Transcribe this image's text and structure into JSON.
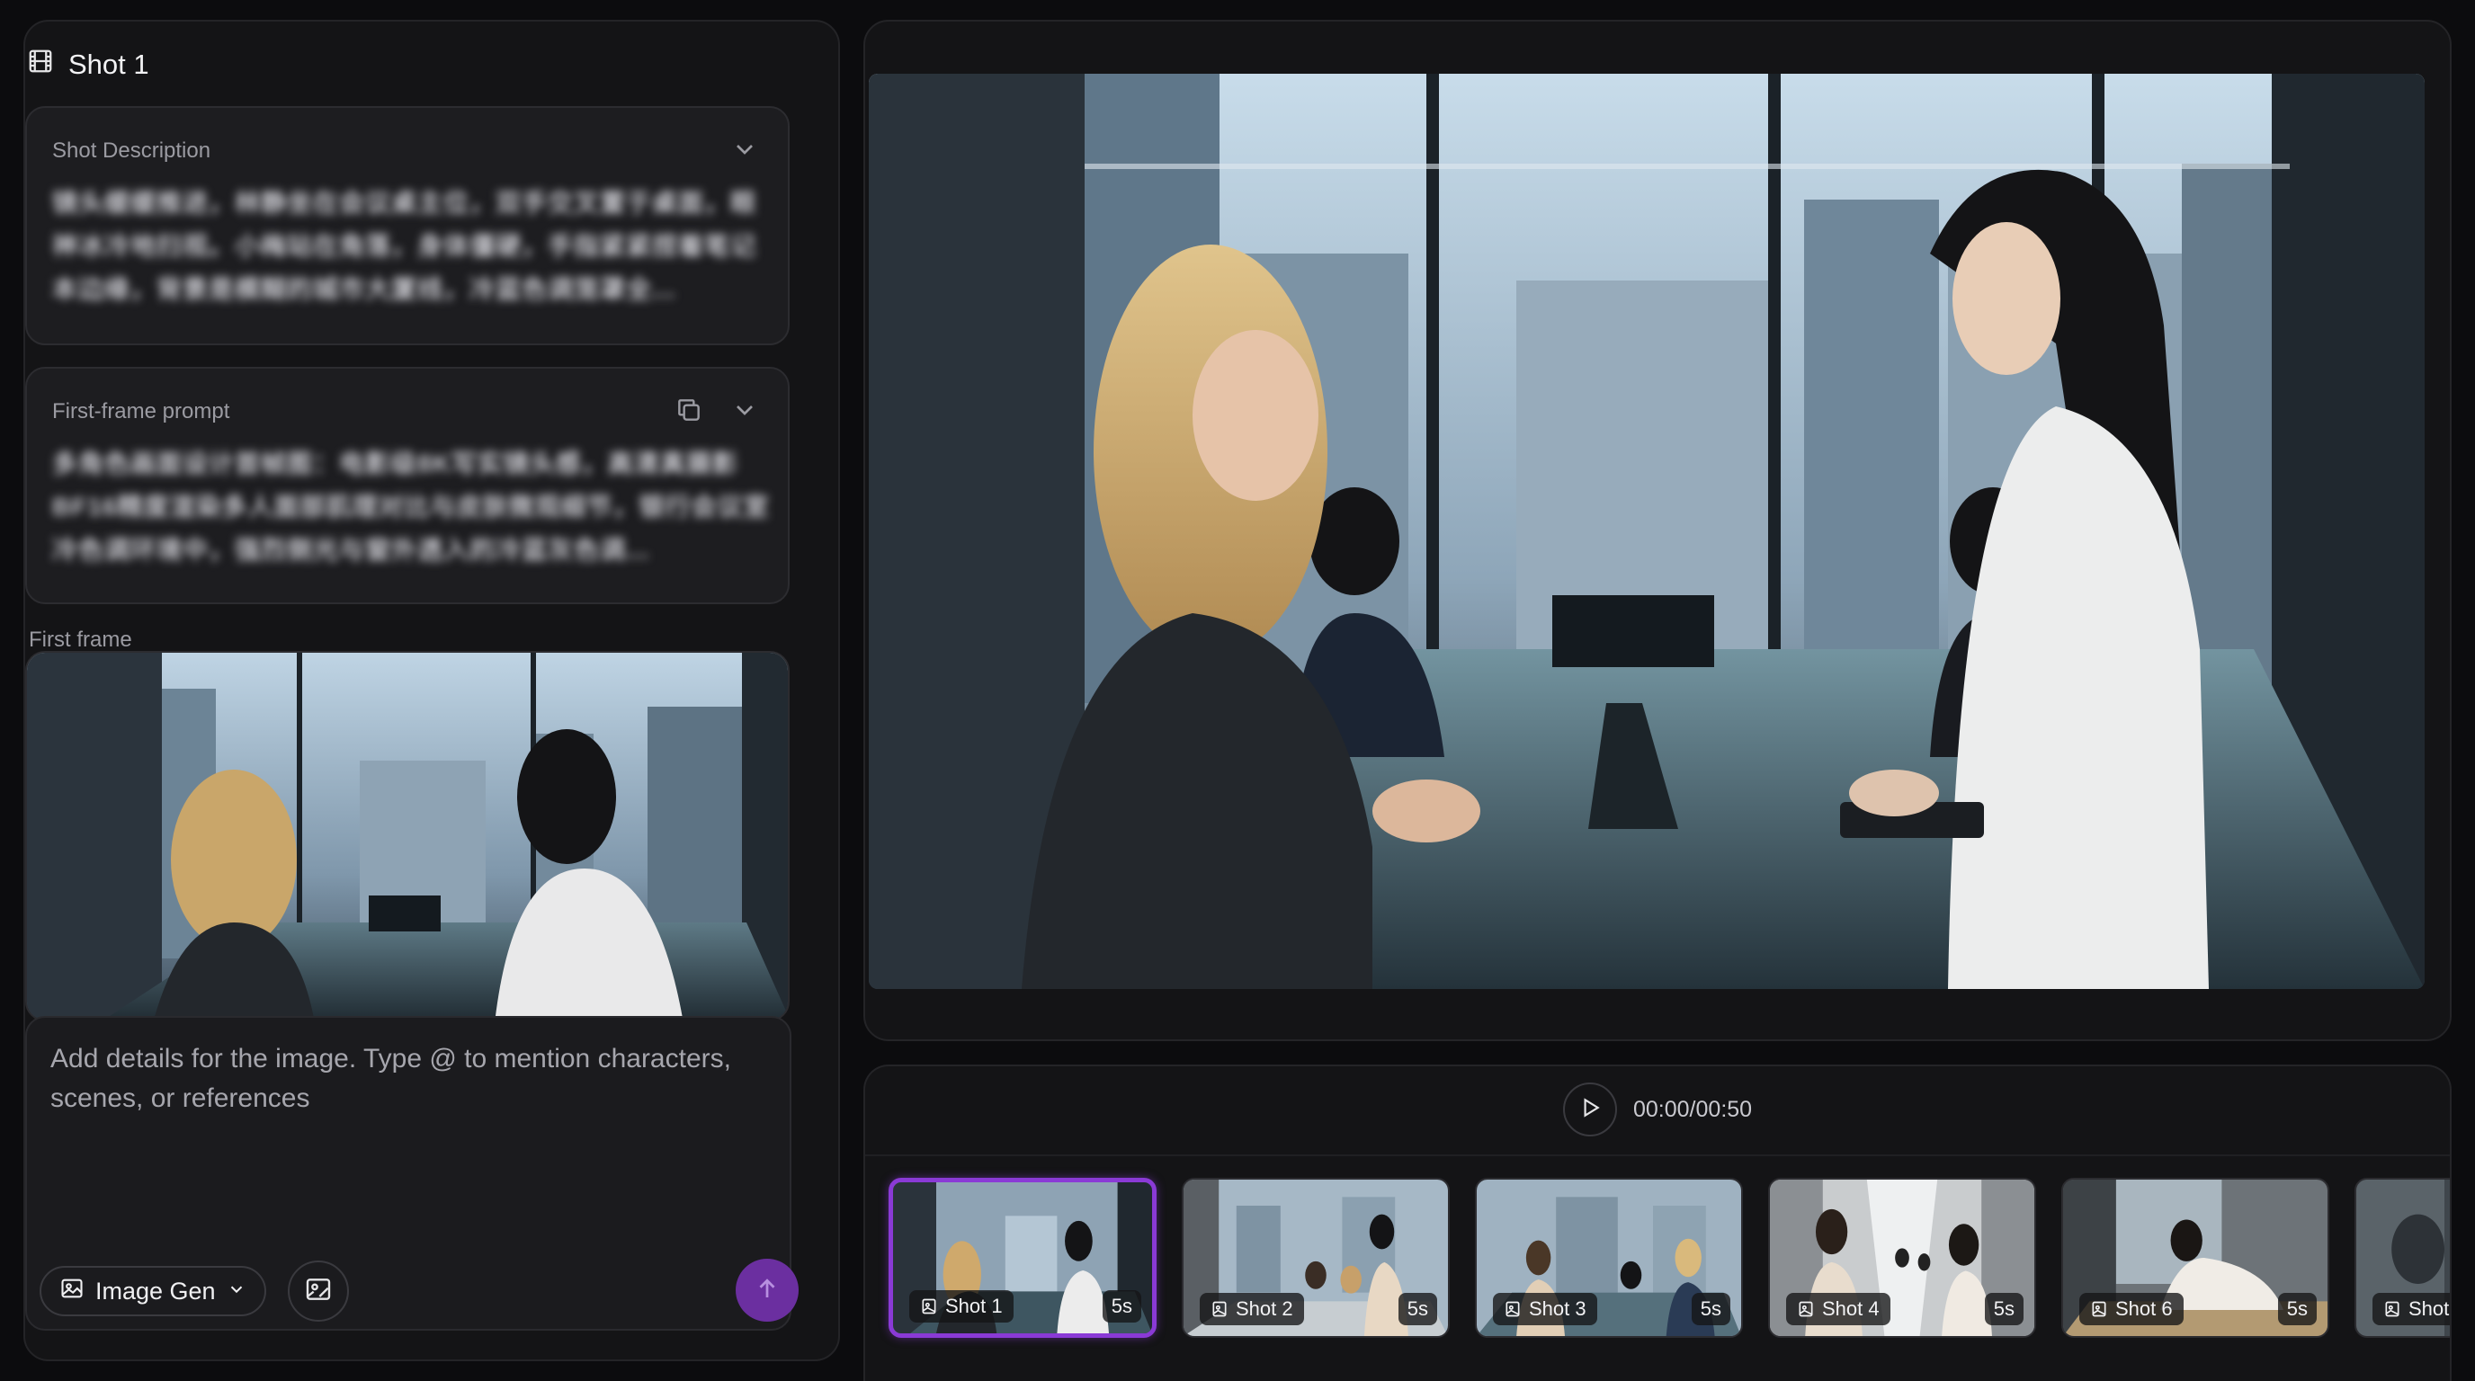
{
  "shot_panel": {
    "title": "Shot 1",
    "title_icon": "film-icon",
    "description": {
      "label": "Shot Description",
      "text": "镜头缓缓推进，林静坐在会议桌主位，双手交叉置于桌面，眼神冰冷地扫视。小梅站在角落，身体僵硬，手指紧紧捏着笔记本边缘，背景是模糊的城市大厦线，冷蓝色调笼罩全..."
    },
    "first_frame_prompt": {
      "label": "First-frame prompt",
      "text": "多角色画面设计首帧图：电影级8K写实镜头感，高清真摄影BF16精度渲染多人面部肌理对比与皮肤微观细节，银行会议室冷色调环境中，强烈侧光与窗外透入的冷蓝灰色调..."
    },
    "first_frame_label": "First frame",
    "prompt_placeholder": "Add details for the image. Type @ to mention characters, scenes, or references",
    "generator_label": "Image Gen",
    "generator_icon": "image-icon"
  },
  "player": {
    "time": "00:00/00:50"
  },
  "shots": [
    {
      "label": "Shot 1",
      "duration": "5s",
      "active": true
    },
    {
      "label": "Shot 2",
      "duration": "5s",
      "active": false
    },
    {
      "label": "Shot 3",
      "duration": "5s",
      "active": false
    },
    {
      "label": "Shot 4",
      "duration": "5s",
      "active": false
    },
    {
      "label": "Shot 6",
      "duration": "5s",
      "active": false
    },
    {
      "label": "Shot",
      "duration": "",
      "active": false
    }
  ],
  "colors": {
    "accent": "#8a3ad6",
    "send_button": "#6b2fa0",
    "panel_bg": "#141416",
    "page_bg": "#0c0c0e"
  }
}
